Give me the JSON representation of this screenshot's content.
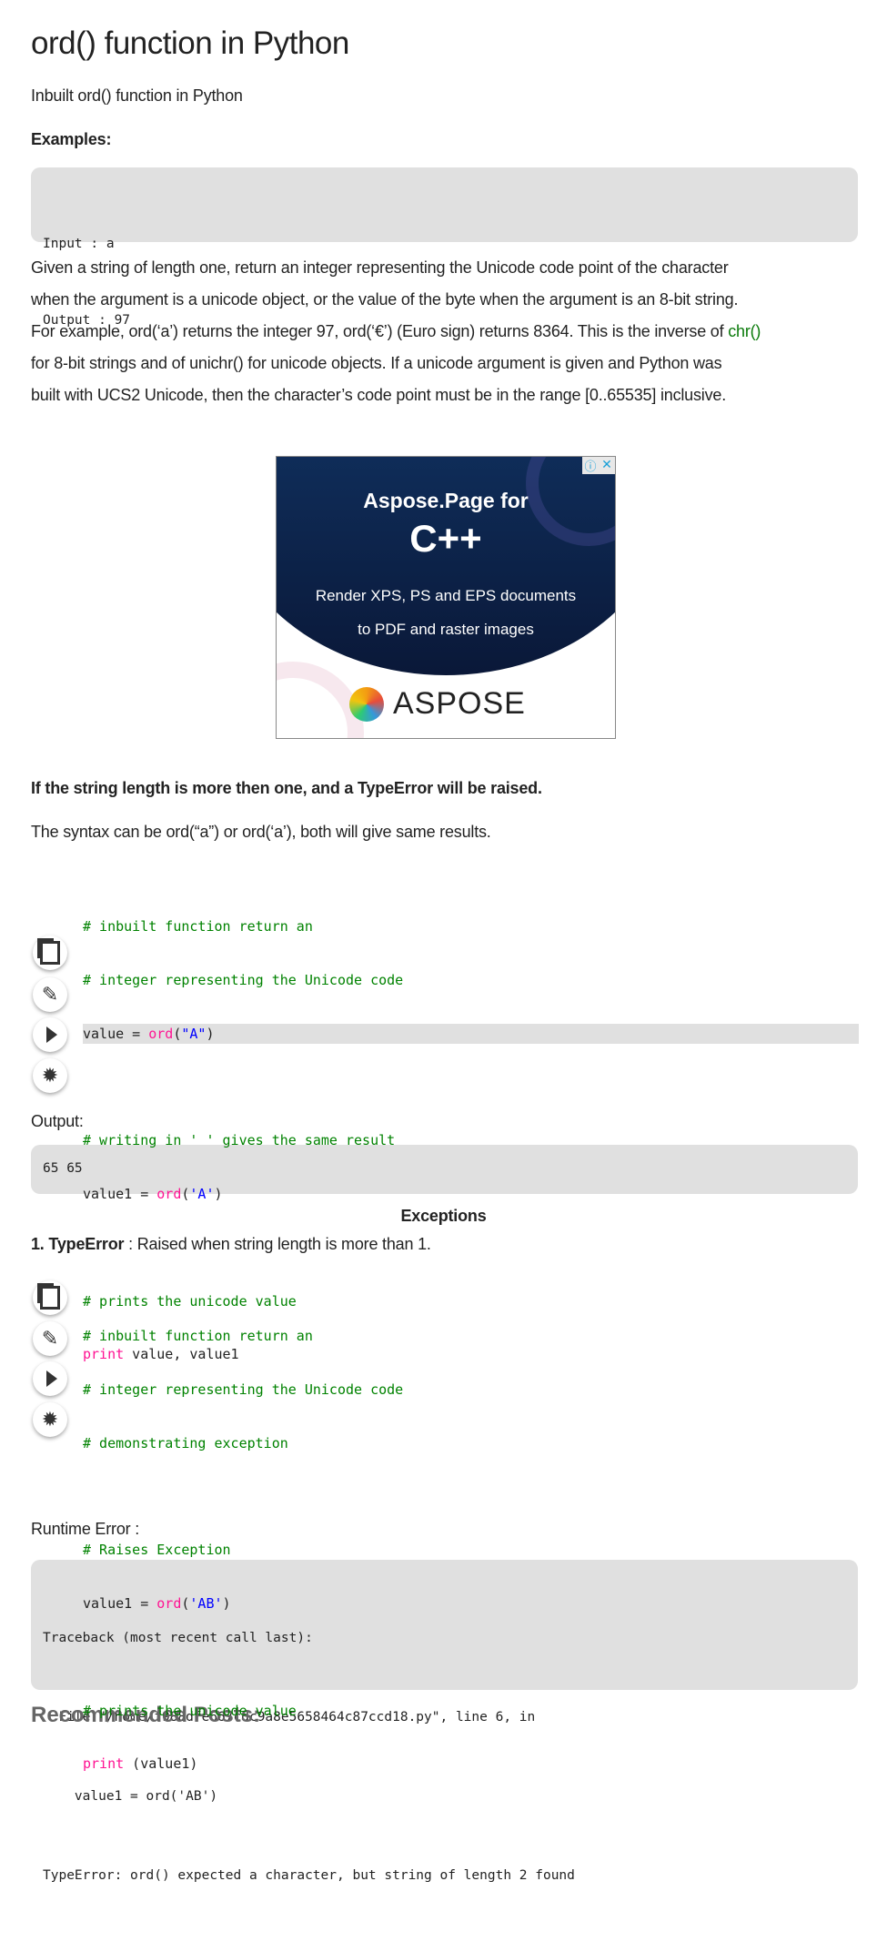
{
  "title": "ord() function in Python",
  "subtitle": "Inbuilt ord() function in Python",
  "examples_label": "Examples:",
  "example_box": [
    "Input : a",
    "Output : 97"
  ],
  "description": {
    "lines": [
      "Given a string of length one, return an integer representing the Unicode code point of the character",
      "when the argument is a unicode object, or the value of the byte when the argument is an 8-bit string.",
      "For example, ord(‘a’) returns the integer 97, ord(‘€’) (Euro sign) returns 8364. This is the inverse of ",
      "for 8-bit strings and of unichr() for unicode objects. If a unicode argument is given and Python was",
      "built with UCS2 Unicode, then the character’s code point must be in the range [0..65535] inclusive."
    ],
    "link": "chr()"
  },
  "ad": {
    "line1": "Aspose.Page for",
    "line2": "C++",
    "line3": "Render XPS, PS and EPS documents",
    "line4": "to PDF and raster images",
    "brand": "ASPOSE",
    "info_icon": "info-icon",
    "close_icon": "close-icon"
  },
  "note_bold": "If the string length is more then one, and a TypeError will be raised.",
  "syntax_text": "The syntax can be ord(“a”) or ord(‘a’), both will give same results.",
  "code1": {
    "c1": "# inbuilt function return an",
    "c2": "# integer representing the Unicode code",
    "l3a": "value = ",
    "l3b": "ord",
    "l3c": "(",
    "l3d": "\"A\"",
    "l3e": ")",
    "c4": "# writing in ' ' gives the same result",
    "l5a": "value1 = ",
    "l5b": "ord",
    "l5c": "(",
    "l5d": "'A'",
    "l5e": ")",
    "c6": "# prints the unicode value",
    "l7a": "print",
    "l7b": " value, value1"
  },
  "output_label": "Output:",
  "output_value": "65 65",
  "exceptions_heading": "Exceptions",
  "typeerror_label": "1. TypeError",
  "typeerror_desc": " : Raised when string length is more than 1.",
  "code2": {
    "c1": "# inbuilt function return an",
    "c2": "# integer representing the Unicode code",
    "c3": "# demonstrating exception",
    "c4": "# Raises Exception",
    "l5a": "value1 = ",
    "l5b": "ord",
    "l5c": "(",
    "l5d": "'AB'",
    "l5e": ")",
    "c6": "# prints the unicode value",
    "l7a": "print",
    "l7b": " (value1)"
  },
  "runtime_label": "Runtime Error :",
  "traceback": [
    "Traceback (most recent call last):",
    "  File \"/home/f988dfe667cdc9a8e5658464c87ccd18.py\", line 6, in",
    "    value1 = ord('AB')",
    "TypeError: ord() expected a character, but string of length 2 found"
  ],
  "recommended": "Recommended Posts:"
}
